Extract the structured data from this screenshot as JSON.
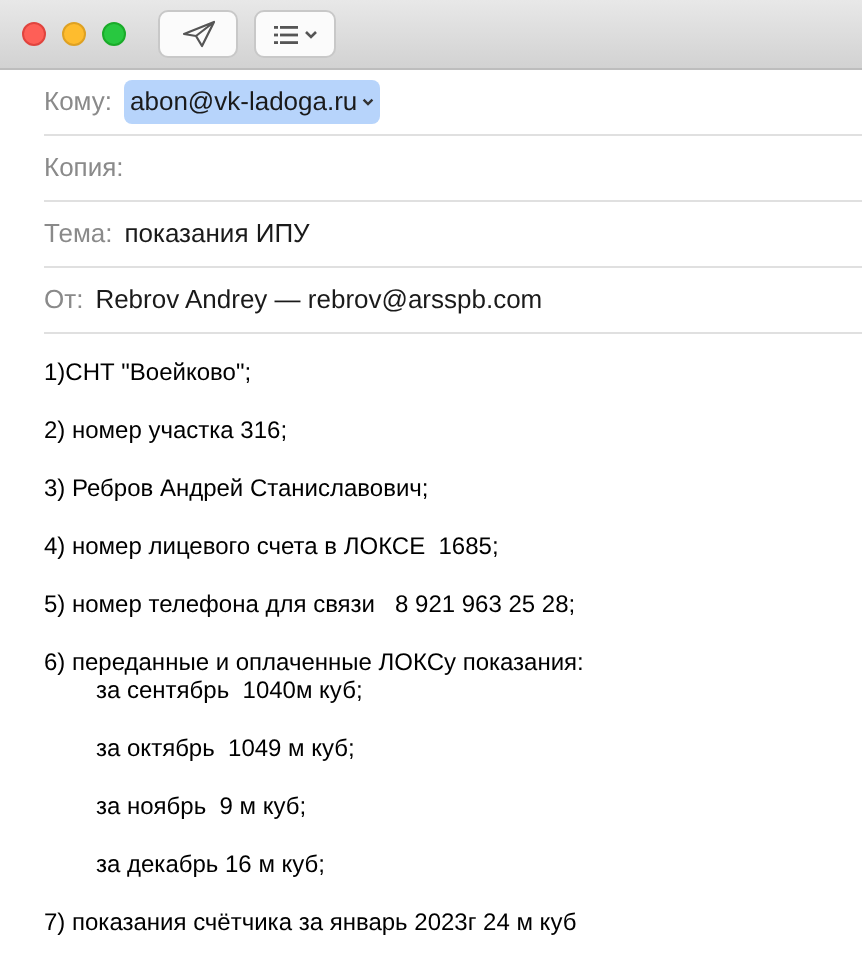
{
  "header_fields": [
    {
      "kind": "recipient",
      "label": "Кому:",
      "value": "abon@vk-ladoga.ru",
      "selected": true
    },
    {
      "kind": "text",
      "label": "Копия:"
    },
    {
      "kind": "text",
      "label": "Тема:",
      "value": "показания ИПУ"
    },
    {
      "kind": "text",
      "label": "От:",
      "value": "Rebrov Andrey — rebrov@arsspb.com"
    }
  ],
  "body": [
    {
      "lines": [
        {
          "text": "1)СНТ \"Воейково\";",
          "indented": false
        }
      ]
    },
    {
      "lines": [
        {
          "text": "2) номер участка 316;",
          "indented": false
        }
      ]
    },
    {
      "lines": [
        {
          "text": "3) Ребров Андрей Станиславович;",
          "indented": false
        }
      ]
    },
    {
      "lines": [
        {
          "text": "4) номер лицевого счета в ЛОКСЕ  1685;",
          "indented": false
        }
      ]
    },
    {
      "lines": [
        {
          "text": "5) номер телефона для связи   8 921 963 25 28;",
          "indented": false
        }
      ]
    },
    {
      "lines": [
        {
          "text": "6) переданные и оплаченные ЛОКСу показания:",
          "indented": false
        },
        {
          "text": "за сентябрь  1040м куб;",
          "indented": true
        }
      ]
    },
    {
      "lines": [
        {
          "text": "за октябрь  1049 м куб;",
          "indented": true
        }
      ]
    },
    {
      "lines": [
        {
          "text": "за ноябрь  9 м куб;",
          "indented": true
        }
      ]
    },
    {
      "lines": [
        {
          "text": "за декабрь 16 м куб;",
          "indented": true
        }
      ]
    },
    {
      "lines": [
        {
          "text": "7) показания счётчика за январь 2023г 24 м куб",
          "indented": false
        }
      ]
    }
  ]
}
